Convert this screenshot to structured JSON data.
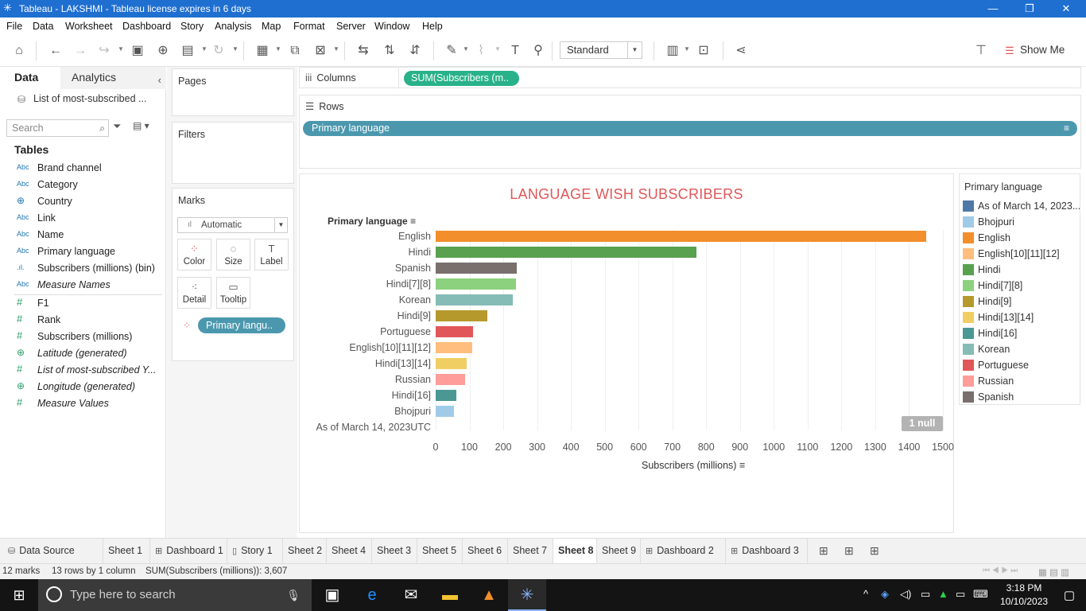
{
  "window": {
    "title": "Tableau - LAKSHMI - Tableau license expires in 6 days",
    "app_icon": "tableau-icon",
    "minimize": "—",
    "restore": "❐",
    "close": "✕"
  },
  "menu": [
    "File",
    "Data",
    "Worksheet",
    "Dashboard",
    "Story",
    "Analysis",
    "Map",
    "Format",
    "Server",
    "Window",
    "Help"
  ],
  "toolbar": {
    "fit_value": "Standard",
    "show_me": "Show Me"
  },
  "data_pane": {
    "tab_data": "Data",
    "tab_analytics": "Analytics",
    "datasource": "List of most-subscribed ...",
    "search_placeholder": "Search",
    "tables_header": "Tables",
    "dimensions": [
      {
        "type": "Abc",
        "name": "Brand channel"
      },
      {
        "type": "Abc",
        "name": "Category"
      },
      {
        "type": "geo",
        "name": "Country"
      },
      {
        "type": "Abc",
        "name": "Link"
      },
      {
        "type": "Abc",
        "name": "Name"
      },
      {
        "type": "Abc",
        "name": "Primary language"
      },
      {
        "type": "bin",
        "name": "Subscribers (millions) (bin)"
      },
      {
        "type": "Abc",
        "name": "Measure Names"
      }
    ],
    "measures": [
      {
        "type": "#",
        "name": "F1"
      },
      {
        "type": "#",
        "name": "Rank"
      },
      {
        "type": "#",
        "name": "Subscribers (millions)"
      },
      {
        "type": "geo",
        "name": "Latitude (generated)"
      },
      {
        "type": "#",
        "name": "List of most-subscribed Y..."
      },
      {
        "type": "geo",
        "name": "Longitude (generated)"
      },
      {
        "type": "#",
        "name": "Measure Values"
      }
    ]
  },
  "cards": {
    "pages": "Pages",
    "filters": "Filters",
    "marks": "Marks",
    "mark_type": "Automatic",
    "buttons": [
      "Color",
      "Size",
      "Label",
      "Detail",
      "Tooltip"
    ],
    "color_pill": "Primary langu.."
  },
  "shelves": {
    "columns_label": "Columns",
    "columns_pill": "SUM(Subscribers (m..",
    "rows_label": "Rows",
    "rows_pill": "Primary language"
  },
  "chart_data": {
    "type": "bar",
    "orientation": "horizontal",
    "title": "LANGUAGE WISH SUBSCRIBERS",
    "row_header": "Primary language",
    "xlabel": "Subscribers (millions)",
    "xlim": [
      0,
      1500
    ],
    "xticks": [
      0,
      100,
      200,
      300,
      400,
      500,
      600,
      700,
      800,
      900,
      1000,
      1100,
      1200,
      1300,
      1400,
      1500
    ],
    "categories": [
      "English",
      "Hindi",
      "Spanish",
      "Hindi[7][8]",
      "Korean",
      "Hindi[9]",
      "Portuguese",
      "English[10][11][12]",
      "Hindi[13][14]",
      "Russian",
      "Hindi[16]",
      "Bhojpuri",
      "As of March 14, 2023UTC"
    ],
    "values": [
      1450,
      772,
      240,
      238,
      228,
      152,
      110,
      107,
      92,
      88,
      62,
      55,
      0
    ],
    "colors": [
      "#f28e2b",
      "#59a14f",
      "#79706e",
      "#8cd17d",
      "#86bcb6",
      "#b6992d",
      "#e15759",
      "#ffbe7d",
      "#f1ce63",
      "#ff9d9a",
      "#499894",
      "#a0cbe8",
      "#4e79a7"
    ],
    "null_badge": "1 null",
    "grid": true
  },
  "legend": {
    "title": "Primary language",
    "items": [
      {
        "label": "As of March 14, 2023...",
        "color": "#4e79a7"
      },
      {
        "label": "Bhojpuri",
        "color": "#a0cbe8"
      },
      {
        "label": "English",
        "color": "#f28e2b"
      },
      {
        "label": "English[10][11][12]",
        "color": "#ffbe7d"
      },
      {
        "label": "Hindi",
        "color": "#59a14f"
      },
      {
        "label": "Hindi[7][8]",
        "color": "#8cd17d"
      },
      {
        "label": "Hindi[9]",
        "color": "#b6992d"
      },
      {
        "label": "Hindi[13][14]",
        "color": "#f1ce63"
      },
      {
        "label": "Hindi[16]",
        "color": "#499894"
      },
      {
        "label": "Korean",
        "color": "#86bcb6"
      },
      {
        "label": "Portuguese",
        "color": "#e15759"
      },
      {
        "label": "Russian",
        "color": "#ff9d9a"
      },
      {
        "label": "Spanish",
        "color": "#79706e"
      }
    ]
  },
  "tabs": {
    "data_source": "Data Source",
    "sheets": [
      {
        "label": "Sheet 1",
        "kind": "sheet"
      },
      {
        "label": "Dashboard 1",
        "kind": "dashboard"
      },
      {
        "label": "Story 1",
        "kind": "story"
      },
      {
        "label": "Sheet 2",
        "kind": "sheet"
      },
      {
        "label": "Sheet 4",
        "kind": "sheet"
      },
      {
        "label": "Sheet 3",
        "kind": "sheet"
      },
      {
        "label": "Sheet 5",
        "kind": "sheet"
      },
      {
        "label": "Sheet 6",
        "kind": "sheet"
      },
      {
        "label": "Sheet 7",
        "kind": "sheet"
      },
      {
        "label": "Sheet 8",
        "kind": "sheet",
        "active": true
      },
      {
        "label": "Sheet 9",
        "kind": "sheet"
      },
      {
        "label": "Dashboard 2",
        "kind": "dashboard"
      },
      {
        "label": "Dashboard 3",
        "kind": "dashboard"
      }
    ]
  },
  "status": {
    "marks": "12 marks",
    "rows": "13 rows by 1 column",
    "sum": "SUM(Subscribers (millions)): 3,607"
  },
  "taskbar": {
    "search_placeholder": "Type here to search",
    "time": "3:18 PM",
    "date": "10/10/2023"
  }
}
